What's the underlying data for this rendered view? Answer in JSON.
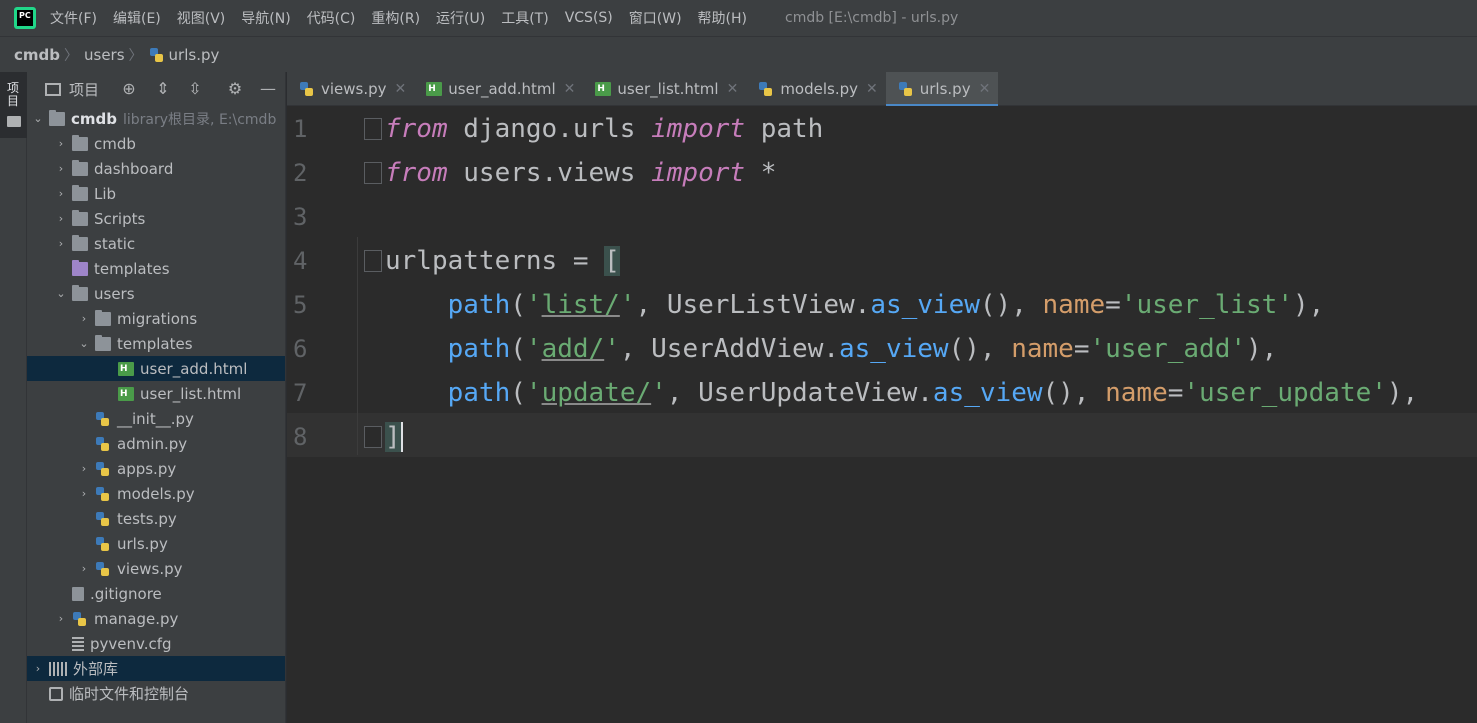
{
  "app": {
    "logo_text": "PC",
    "window_title": "cmdb [E:\\cmdb] - urls.py"
  },
  "menu": [
    "文件(F)",
    "编辑(E)",
    "视图(V)",
    "导航(N)",
    "代码(C)",
    "重构(R)",
    "运行(U)",
    "工具(T)",
    "VCS(S)",
    "窗口(W)",
    "帮助(H)"
  ],
  "breadcrumb": {
    "items": [
      "cmdb",
      "users",
      "urls.py"
    ]
  },
  "toolstrip": {
    "project_tab_label": "项目"
  },
  "project_panel": {
    "title": "项目",
    "root": {
      "name": "cmdb",
      "detail": "library根目录, E:\\cmdb"
    },
    "tree": [
      {
        "label": "cmdb",
        "indent": 1,
        "arrow": "right",
        "icon": "folder"
      },
      {
        "label": "dashboard",
        "indent": 1,
        "arrow": "right",
        "icon": "folder"
      },
      {
        "label": "Lib",
        "indent": 1,
        "arrow": "right",
        "icon": "folder"
      },
      {
        "label": "Scripts",
        "indent": 1,
        "arrow": "right",
        "icon": "folder"
      },
      {
        "label": "static",
        "indent": 1,
        "arrow": "right",
        "icon": "folder"
      },
      {
        "label": "templates",
        "indent": 1,
        "arrow": "none",
        "icon": "folder-purple"
      },
      {
        "label": "users",
        "indent": 1,
        "arrow": "down",
        "icon": "folder"
      },
      {
        "label": "migrations",
        "indent": 2,
        "arrow": "right",
        "icon": "folder"
      },
      {
        "label": "templates",
        "indent": 2,
        "arrow": "down",
        "icon": "folder"
      },
      {
        "label": "user_add.html",
        "indent": 3,
        "arrow": "none",
        "icon": "html",
        "selected": true
      },
      {
        "label": "user_list.html",
        "indent": 3,
        "arrow": "none",
        "icon": "html"
      },
      {
        "label": "__init__.py",
        "indent": 2,
        "arrow": "none",
        "icon": "py"
      },
      {
        "label": "admin.py",
        "indent": 2,
        "arrow": "none",
        "icon": "py"
      },
      {
        "label": "apps.py",
        "indent": 2,
        "arrow": "right",
        "icon": "py"
      },
      {
        "label": "models.py",
        "indent": 2,
        "arrow": "right",
        "icon": "py"
      },
      {
        "label": "tests.py",
        "indent": 2,
        "arrow": "none",
        "icon": "py"
      },
      {
        "label": "urls.py",
        "indent": 2,
        "arrow": "none",
        "icon": "py"
      },
      {
        "label": "views.py",
        "indent": 2,
        "arrow": "right",
        "icon": "py"
      },
      {
        "label": ".gitignore",
        "indent": 1,
        "arrow": "none",
        "icon": "git"
      },
      {
        "label": "manage.py",
        "indent": 1,
        "arrow": "right",
        "icon": "py"
      },
      {
        "label": "pyvenv.cfg",
        "indent": 1,
        "arrow": "none",
        "icon": "cfg"
      }
    ],
    "external_libraries": "外部库",
    "scratches": "临时文件和控制台"
  },
  "tabs": [
    {
      "label": "views.py",
      "icon": "py",
      "active": false
    },
    {
      "label": "user_add.html",
      "icon": "html",
      "active": false
    },
    {
      "label": "user_list.html",
      "icon": "html",
      "active": false
    },
    {
      "label": "models.py",
      "icon": "py",
      "active": false
    },
    {
      "label": "urls.py",
      "icon": "py",
      "active": true
    }
  ],
  "editor": {
    "line_numbers": [
      "1",
      "2",
      "3",
      "4",
      "5",
      "6",
      "7",
      "8"
    ],
    "code": {
      "l1": {
        "kw1": "from",
        "mod": " django.urls ",
        "kw2": "import",
        "name": " path"
      },
      "l2": {
        "kw1": "from",
        "mod": " users.views ",
        "kw2": "import",
        "name": " *"
      },
      "l4": {
        "name": "urlpatterns = ",
        "bracket": "["
      },
      "routes": [
        {
          "fn": "path",
          "route": "list/",
          "view": "UserListView",
          "method": "as_view",
          "kw": "name",
          "name": "'user_list'"
        },
        {
          "fn": "path",
          "route": "add/",
          "view": "UserAddView",
          "method": "as_view",
          "kw": "name",
          "name": "'user_add'"
        },
        {
          "fn": "path",
          "route": "update/",
          "view": "UserUpdateView",
          "method": "as_view",
          "kw": "name",
          "name": "'user_update'"
        }
      ],
      "l8": {
        "bracket": "]"
      }
    }
  }
}
